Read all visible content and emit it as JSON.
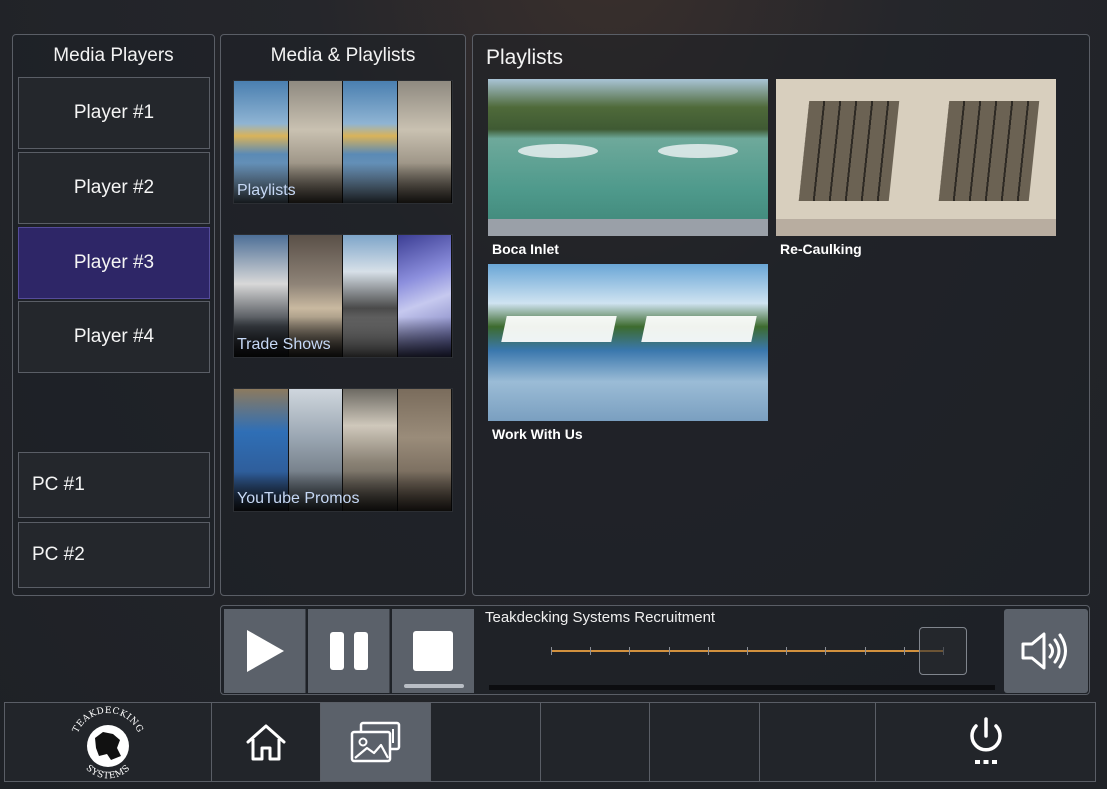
{
  "players_panel": {
    "title": "Media Players",
    "players": [
      {
        "label": "Player #1",
        "active": false
      },
      {
        "label": "Player #2",
        "active": false
      },
      {
        "label": "Player #3",
        "active": true
      },
      {
        "label": "Player #4",
        "active": false
      }
    ],
    "pcs": [
      {
        "label": "PC #1"
      },
      {
        "label": "PC #2"
      }
    ]
  },
  "media_panel": {
    "title": "Media & Playlists",
    "tiles": [
      {
        "label": "Playlists"
      },
      {
        "label": "Trade Shows"
      },
      {
        "label": "YouTube Promos"
      }
    ]
  },
  "playlists_panel": {
    "title": "Playlists",
    "items": [
      {
        "label": "Boca Inlet"
      },
      {
        "label": "Re-Caulking"
      },
      {
        "label": "Work With Us"
      }
    ]
  },
  "transport": {
    "track_title": "Teakdecking Systems Recruitment",
    "position": 0.93,
    "buttons": [
      "play-icon",
      "pause-icon",
      "stop-icon"
    ],
    "volume_icon": "speaker-icon",
    "accent": "#d2913e"
  },
  "navbar": {
    "logo_text_top": "TEAKDECKING",
    "logo_text_bottom": "SYSTEMS",
    "items": [
      "home-icon",
      "media-gallery-icon",
      "power-icon"
    ]
  },
  "colors": {
    "active_player": "#2e2667",
    "button_gray": "#5b616a",
    "tile_label": "#c6d8f5"
  }
}
